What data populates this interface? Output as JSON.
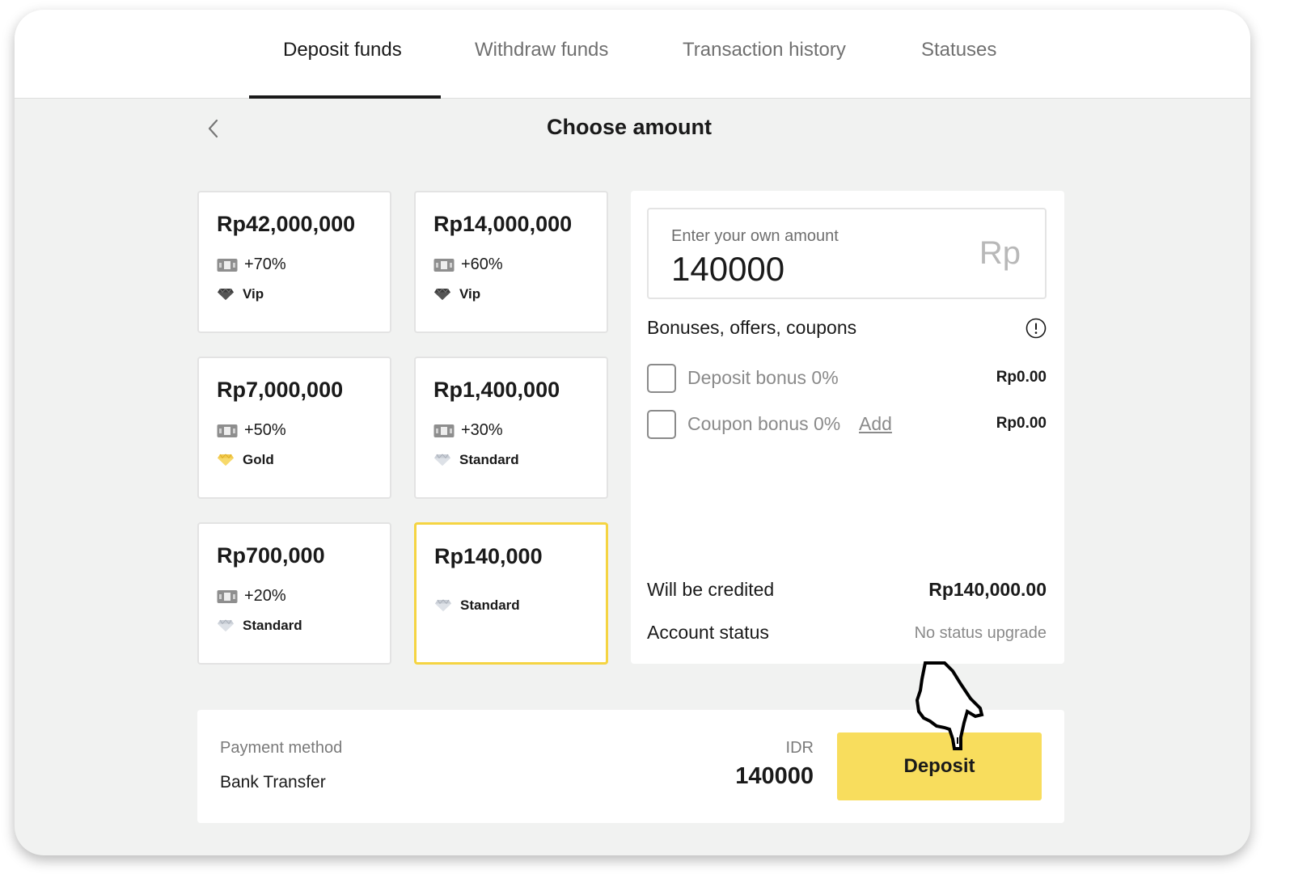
{
  "tabs": [
    {
      "label": "Deposit funds",
      "active": true
    },
    {
      "label": "Withdraw funds",
      "active": false
    },
    {
      "label": "Transaction history",
      "active": false
    },
    {
      "label": "Statuses",
      "active": false
    }
  ],
  "page": {
    "title": "Choose amount"
  },
  "amount_options": [
    {
      "amount": "Rp42,000,000",
      "bonus": "+70%",
      "status": "Vip",
      "status_icon": "diamond-dark-icon"
    },
    {
      "amount": "Rp14,000,000",
      "bonus": "+60%",
      "status": "Vip",
      "status_icon": "diamond-dark-icon"
    },
    {
      "amount": "Rp7,000,000",
      "bonus": "+50%",
      "status": "Gold",
      "status_icon": "diamond-gold-icon"
    },
    {
      "amount": "Rp1,400,000",
      "bonus": "+30%",
      "status": "Standard",
      "status_icon": "diamond-silver-icon"
    },
    {
      "amount": "Rp700,000",
      "bonus": "+20%",
      "status": "Standard",
      "status_icon": "diamond-silver-icon"
    },
    {
      "amount": "Rp140,000",
      "status": "Standard",
      "status_icon": "diamond-silver-icon",
      "selected": true
    }
  ],
  "custom_amount": {
    "label": "Enter your own amount",
    "value": "140000",
    "currency_symbol": "Rp"
  },
  "bonuses": {
    "heading": "Bonuses, offers, coupons",
    "items": [
      {
        "label": "Deposit bonus 0%",
        "value": "Rp0.00",
        "checked": false
      },
      {
        "label": "Coupon bonus 0%",
        "link_label": "Add",
        "value": "Rp0.00",
        "checked": false
      }
    ]
  },
  "summary": {
    "credited_label": "Will be credited",
    "credited_value": "Rp140,000.00",
    "status_label": "Account status",
    "status_value": "No status upgrade"
  },
  "payment": {
    "method_label": "Payment method",
    "method_value": "Bank Transfer",
    "currency": "IDR",
    "amount": "140000",
    "deposit_label": "Deposit"
  },
  "colors": {
    "accent": "#f8dd5d",
    "selected_border": "#f5d442",
    "background": "#f1f2f1",
    "muted_text": "#8a8a8a"
  }
}
